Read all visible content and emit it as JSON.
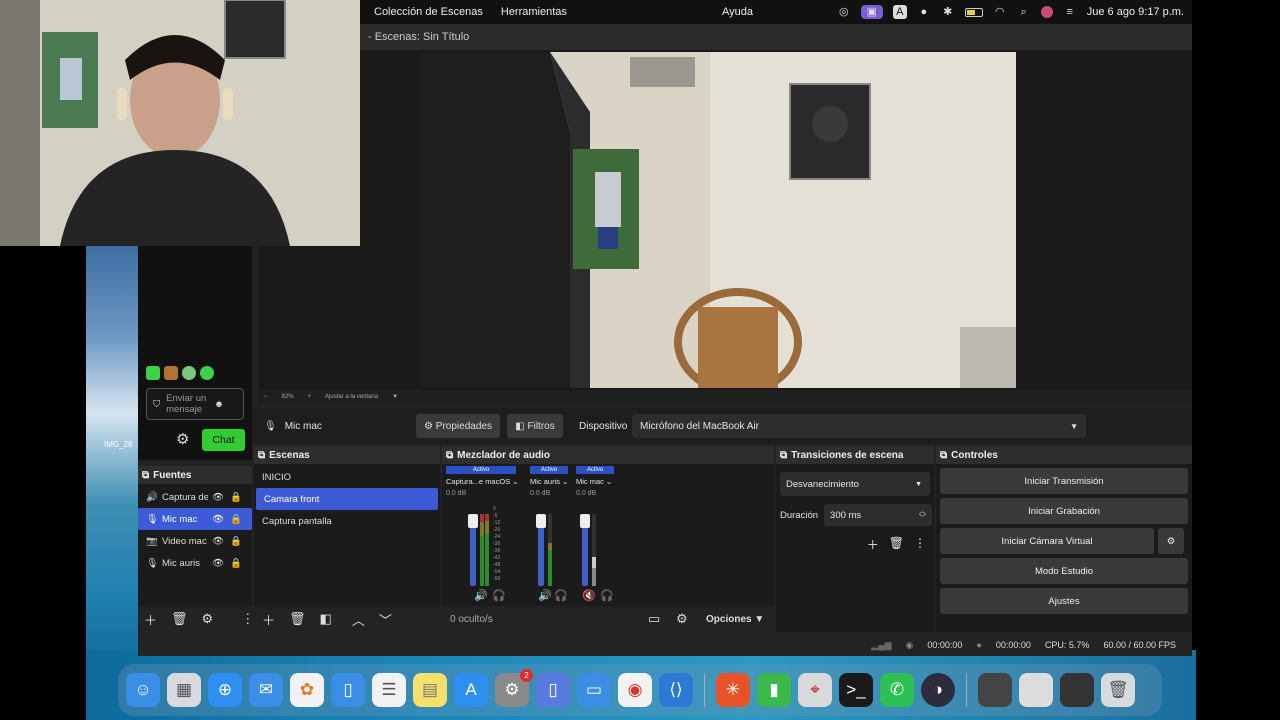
{
  "menubar": {
    "items": [
      "Colección de Escenas",
      "Herramientas"
    ],
    "help": "Ayuda",
    "datetime": "Jue 6 ago 9:17 p.m."
  },
  "window": {
    "title": "- Escenas: Sin Título"
  },
  "chat": {
    "input_placeholder": "Enviar un mensaje",
    "chat_button": "Chat"
  },
  "zoom": {
    "minus": "−",
    "value": "82%",
    "plus": "+",
    "fit": "Ajustar a la ventana"
  },
  "source_bar": {
    "source_name": "Mic mac",
    "properties": "Propiedades",
    "filters": "Filtros",
    "device_label": "Dispositivo",
    "device_value": "Micrófono del MacBook Air"
  },
  "fuentes": {
    "title": "Fuentes",
    "items": [
      "Captura de",
      "Mic mac",
      "Video mac",
      "Mic auris"
    ],
    "selected": 1
  },
  "escenas": {
    "title": "Escenas",
    "items": [
      "INICIO",
      "Camara front",
      "Captura pantalla"
    ],
    "selected": 1
  },
  "mixer": {
    "title": "Mezclador de audio",
    "hidden": "0 oculto/s",
    "options": "Opciones",
    "channels": [
      {
        "name": "Captura...e macOS",
        "status": "Activo",
        "db": "0.0 dB"
      },
      {
        "name": "Mic auris",
        "status": "Activo",
        "db": "0.0 dB"
      },
      {
        "name": "Mic mac",
        "status": "Activo",
        "db": "0.0 dB"
      }
    ],
    "scale": [
      "0",
      "-5",
      "-12",
      "-20",
      "-24",
      "-30",
      "-36",
      "-42",
      "-48",
      "-54",
      "-60"
    ]
  },
  "transiciones": {
    "title": "Transiciones de escena",
    "type": "Desvanecimiento",
    "duration_label": "Duración",
    "duration_value": "300 ms"
  },
  "controles": {
    "title": "Controles",
    "buttons": [
      "Iniciar Transmisión",
      "Iniciar Grabación",
      "Iniciar Cámara Virtual",
      "Modo Estudio",
      "Ajustes"
    ]
  },
  "status": {
    "time1": "00:00:00",
    "time2": "00:00:00",
    "cpu": "CPU: 5.7%",
    "fps": "60.00 / 60.00 FPS"
  },
  "desktop": {
    "file_label": "IMG_26"
  },
  "dock": {
    "apps": [
      "finder-icon",
      "launchpad-icon",
      "safari-icon",
      "mail-icon",
      "photos-icon",
      "keynote-icon",
      "reminders-icon",
      "notes-icon",
      "app-store-icon",
      "system-settings-icon",
      "preview-icon",
      "files-icon",
      "chrome-icon",
      "vscode-icon",
      "spark-icon",
      "numbers-icon",
      "acrobat-icon",
      "terminal-icon",
      "whatsapp-icon",
      "obs-icon"
    ],
    "badge": "2"
  }
}
